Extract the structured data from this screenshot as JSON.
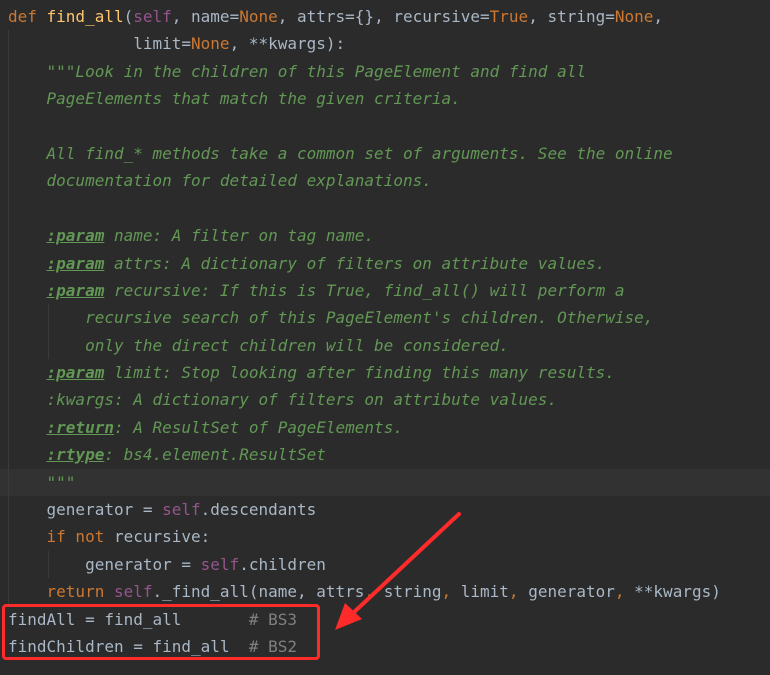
{
  "code": {
    "lines": [
      {
        "indent": 0,
        "guides": [],
        "tokens": [
          {
            "t": "def ",
            "c": "kw"
          },
          {
            "t": "find_all",
            "c": "fn"
          },
          {
            "t": "(",
            "c": "plain"
          },
          {
            "t": "self",
            "c": "self"
          },
          {
            "t": ", name=",
            "c": "plain"
          },
          {
            "t": "None",
            "c": "kw"
          },
          {
            "t": ", attrs={}, recursive=",
            "c": "plain"
          },
          {
            "t": "True",
            "c": "kw"
          },
          {
            "t": ", string=",
            "c": "plain"
          },
          {
            "t": "None",
            "c": "kw"
          },
          {
            "t": ",",
            "c": "plain"
          }
        ]
      },
      {
        "indent": 0,
        "guides": [
          8
        ],
        "tokens": [
          {
            "t": "             limit=",
            "c": "plain"
          },
          {
            "t": "None",
            "c": "kw"
          },
          {
            "t": ", **kwargs):",
            "c": "plain"
          }
        ]
      },
      {
        "indent": 4,
        "guides": [
          8
        ],
        "tokens": [
          {
            "t": "\"\"\"Look in the children of this PageElement and find all",
            "c": "doc"
          }
        ]
      },
      {
        "indent": 4,
        "guides": [
          8
        ],
        "tokens": [
          {
            "t": "PageElements that match the given criteria.",
            "c": "doc"
          }
        ]
      },
      {
        "indent": 0,
        "guides": [
          8
        ],
        "tokens": []
      },
      {
        "indent": 4,
        "guides": [
          8
        ],
        "tokens": [
          {
            "t": "All find_* methods take a common set of arguments. See the online",
            "c": "doc"
          }
        ]
      },
      {
        "indent": 4,
        "guides": [
          8
        ],
        "tokens": [
          {
            "t": "documentation for detailed explanations.",
            "c": "doc"
          }
        ]
      },
      {
        "indent": 0,
        "guides": [
          8
        ],
        "tokens": []
      },
      {
        "indent": 4,
        "guides": [
          8
        ],
        "tokens": [
          {
            "t": ":param",
            "c": "tag"
          },
          {
            "t": " name: A filter on tag name.",
            "c": "doc"
          }
        ]
      },
      {
        "indent": 4,
        "guides": [
          8
        ],
        "tokens": [
          {
            "t": ":param",
            "c": "tag"
          },
          {
            "t": " attrs: A dictionary of filters on attribute values.",
            "c": "doc"
          }
        ]
      },
      {
        "indent": 4,
        "guides": [
          8
        ],
        "tokens": [
          {
            "t": ":param",
            "c": "tag"
          },
          {
            "t": " recursive: If this is True, find_all() will perform a",
            "c": "doc"
          }
        ]
      },
      {
        "indent": 8,
        "guides": [
          8,
          48
        ],
        "tokens": [
          {
            "t": "recursive search of this PageElement's children. Otherwise,",
            "c": "doc"
          }
        ]
      },
      {
        "indent": 8,
        "guides": [
          8,
          48
        ],
        "tokens": [
          {
            "t": "only the direct children will be considered.",
            "c": "doc"
          }
        ]
      },
      {
        "indent": 4,
        "guides": [
          8
        ],
        "tokens": [
          {
            "t": ":param",
            "c": "tag"
          },
          {
            "t": " limit: Stop looking after finding this many results.",
            "c": "doc"
          }
        ]
      },
      {
        "indent": 4,
        "guides": [
          8
        ],
        "tokens": [
          {
            "t": ":kwargs: A dictionary of filters on attribute values.",
            "c": "doc"
          }
        ]
      },
      {
        "indent": 4,
        "guides": [
          8
        ],
        "tokens": [
          {
            "t": ":return",
            "c": "tag"
          },
          {
            "t": ": A ResultSet of PageElements.",
            "c": "doc"
          }
        ]
      },
      {
        "indent": 4,
        "guides": [
          8
        ],
        "tokens": [
          {
            "t": ":rtype",
            "c": "tag"
          },
          {
            "t": ": bs4.element.ResultSet",
            "c": "doc"
          }
        ]
      },
      {
        "indent": 4,
        "guides": [
          8
        ],
        "caret": true,
        "tokens": [
          {
            "t": "\"\"\"",
            "c": "doc"
          }
        ]
      },
      {
        "indent": 4,
        "guides": [
          8
        ],
        "tokens": [
          {
            "t": "generator = ",
            "c": "plain"
          },
          {
            "t": "self",
            "c": "self"
          },
          {
            "t": ".descendants",
            "c": "plain"
          }
        ]
      },
      {
        "indent": 4,
        "guides": [
          8
        ],
        "tokens": [
          {
            "t": "if not ",
            "c": "kw"
          },
          {
            "t": "recursive:",
            "c": "plain"
          }
        ]
      },
      {
        "indent": 8,
        "guides": [
          8,
          48
        ],
        "tokens": [
          {
            "t": "generator = ",
            "c": "plain"
          },
          {
            "t": "self",
            "c": "self"
          },
          {
            "t": ".children",
            "c": "plain"
          }
        ]
      },
      {
        "indent": 4,
        "guides": [
          8
        ],
        "tokens": [
          {
            "t": "return ",
            "c": "kw"
          },
          {
            "t": "self",
            "c": "self"
          },
          {
            "t": "._find_all(name, attrs",
            "c": "plain"
          },
          {
            "t": ", ",
            "c": "kw"
          },
          {
            "t": "string",
            "c": "plain"
          },
          {
            "t": ", ",
            "c": "kw"
          },
          {
            "t": "limit",
            "c": "plain"
          },
          {
            "t": ", ",
            "c": "kw"
          },
          {
            "t": "generator",
            "c": "plain"
          },
          {
            "t": ", ",
            "c": "kw"
          },
          {
            "t": "**kwargs)",
            "c": "plain"
          }
        ]
      },
      {
        "indent": 0,
        "guides": [],
        "tokens": [
          {
            "t": "findAll = find_all       ",
            "c": "plain"
          },
          {
            "t": "# BS3",
            "c": "cmt"
          }
        ]
      },
      {
        "indent": 0,
        "guides": [],
        "tokens": [
          {
            "t": "findChildren = find_all  ",
            "c": "plain"
          },
          {
            "t": "# BS2",
            "c": "cmt"
          }
        ]
      }
    ]
  },
  "annotation": {
    "box_color": "#ff2a2a",
    "arrow_color": "#ff2a2a"
  }
}
